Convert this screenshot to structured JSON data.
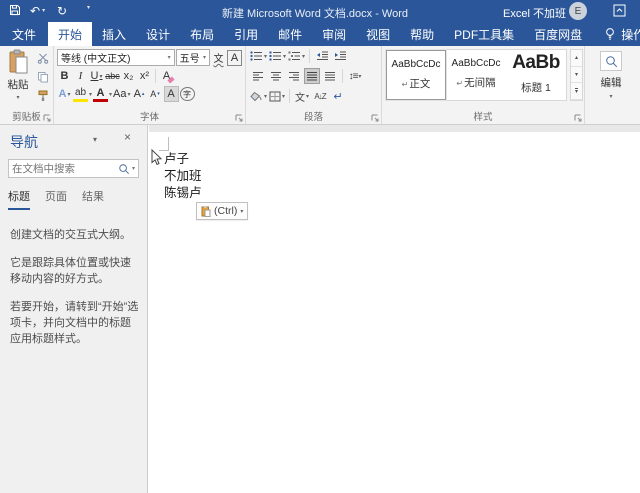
{
  "window": {
    "title": "新建 Microsoft Word 文档.docx - Word",
    "user": "Excel 不加班",
    "avatar_initial": "E"
  },
  "tabs": {
    "file": "文件",
    "items": [
      "开始",
      "插入",
      "设计",
      "布局",
      "引用",
      "邮件",
      "审阅",
      "视图",
      "帮助",
      "PDF工具集",
      "百度网盘"
    ],
    "tellme": "操作说明搜索"
  },
  "ribbon": {
    "clipboard": {
      "group": "剪贴板",
      "paste": "粘贴"
    },
    "font": {
      "group": "字体",
      "name": "等线 (中文正文)",
      "size": "五号",
      "glyphs": {
        "phonetic": "文",
        "char_border": "A",
        "bold": "B",
        "italic": "I",
        "underline": "U",
        "strike": "abc",
        "subscript": "x₂",
        "superscript": "x²",
        "clear": "A",
        "effects": "A",
        "highlight": "ab",
        "color": "A",
        "case": "Aa",
        "grow": "A",
        "shrink": "A",
        "shade": "A",
        "enclose": "字"
      }
    },
    "paragraph": {
      "group": "段落",
      "glyphs": {
        "spacing": "↕≡",
        "asian": "文",
        "sort": "A↓Z",
        "marks": "↵"
      }
    },
    "styles": {
      "group": "样式",
      "items": [
        {
          "preview": "AaBbCcDc",
          "name": "正文",
          "marker": "↵"
        },
        {
          "preview": "AaBbCcDc",
          "name": "无间隔",
          "marker": "↵"
        },
        {
          "preview": "AaBb",
          "name": "标题 1",
          "marker": ""
        }
      ]
    },
    "editing": {
      "group": "编辑"
    }
  },
  "nav": {
    "title": "导航",
    "search_placeholder": "在文档中搜索",
    "tabs": [
      "标题",
      "页面",
      "结果"
    ],
    "body": [
      "创建文档的交互式大纲。",
      "它是跟踪具体位置或快速移动内容的好方式。",
      "若要开始，请转到“开始”选项卡，并向文档中的标题应用标题样式。"
    ]
  },
  "document": {
    "lines": [
      "卢子",
      "不加班",
      "陈锡卢"
    ],
    "paste_options": "(Ctrl)"
  },
  "glyphs": {
    "dropdown": "▾",
    "undo": "↶",
    "redo": "↻",
    "close": "×",
    "up": "▴",
    "down": "▾"
  },
  "colors": {
    "accent": "#2b579a",
    "highlight": "#ffe400",
    "font_red": "#c00000"
  }
}
